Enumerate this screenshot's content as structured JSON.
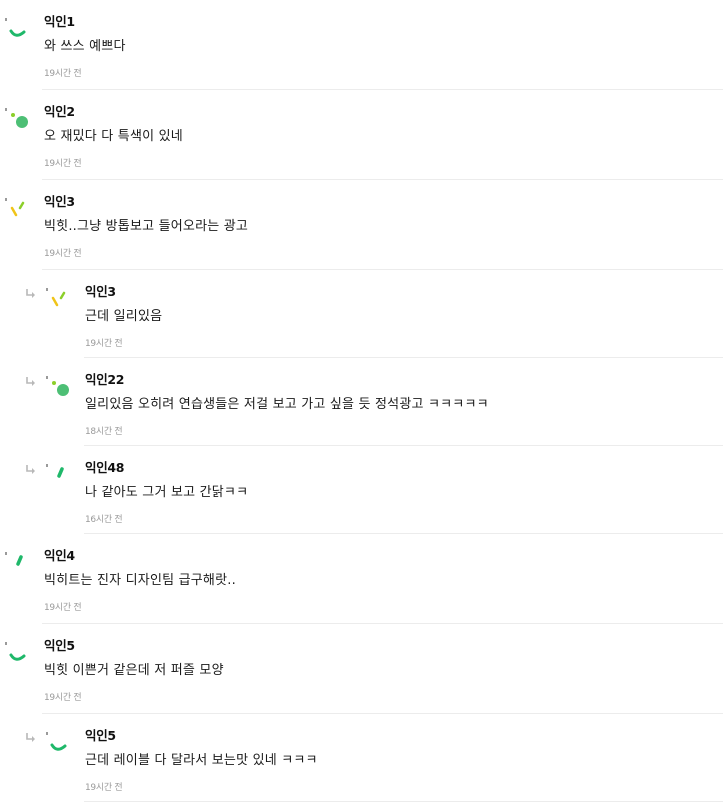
{
  "comments": [
    {
      "nickname": "익인1",
      "text": "와 쓰스 예쁘다",
      "time": "19시간 전",
      "reply": false,
      "avatar": "green-arc"
    },
    {
      "nickname": "익인2",
      "text": "오 재밌다 다 특색이 있네",
      "time": "19시간 전",
      "reply": false,
      "avatar": "green-dot"
    },
    {
      "nickname": "익인3",
      "text": "빅힛..그냥 방톱보고 들어오라는 광고",
      "time": "19시간 전",
      "reply": false,
      "avatar": "lime-yellow-dashes"
    },
    {
      "nickname": "익인3",
      "text": "근데 일리있음",
      "time": "19시간 전",
      "reply": true,
      "avatar": "lime-yellow-dashes"
    },
    {
      "nickname": "익인22",
      "text": "일리있음 오히려 연습생들은 저걸 보고 가고 싶을 듯 정석광고 ㅋㅋㅋㅋㅋ",
      "time": "18시간 전",
      "reply": true,
      "avatar": "green-dot"
    },
    {
      "nickname": "익인48",
      "text": "나 같아도 그거 보고 간닭ㅋㅋ",
      "time": "16시간 전",
      "reply": true,
      "avatar": "green-slash"
    },
    {
      "nickname": "익인4",
      "text": "빅히트는 진자 디자인팀 급구해랏..",
      "time": "19시간 전",
      "reply": false,
      "avatar": "green-slash"
    },
    {
      "nickname": "익인5",
      "text": "빅힛 이쁜거 같은데 저 퍼즐 모양",
      "time": "19시간 전",
      "reply": false,
      "avatar": "green-arc"
    },
    {
      "nickname": "익인5",
      "text": "근데 레이블 다 달라서 보는맛 있네 ㅋㅋㅋ",
      "time": "19시간 전",
      "reply": true,
      "avatar": "green-arc"
    }
  ],
  "colors": {
    "green": "#1fb86a",
    "green_soft": "#4dbf75",
    "lime": "#8ccf2a",
    "yellow": "#f0c419",
    "time": "#9a9a9a",
    "separator": "#ececec"
  }
}
